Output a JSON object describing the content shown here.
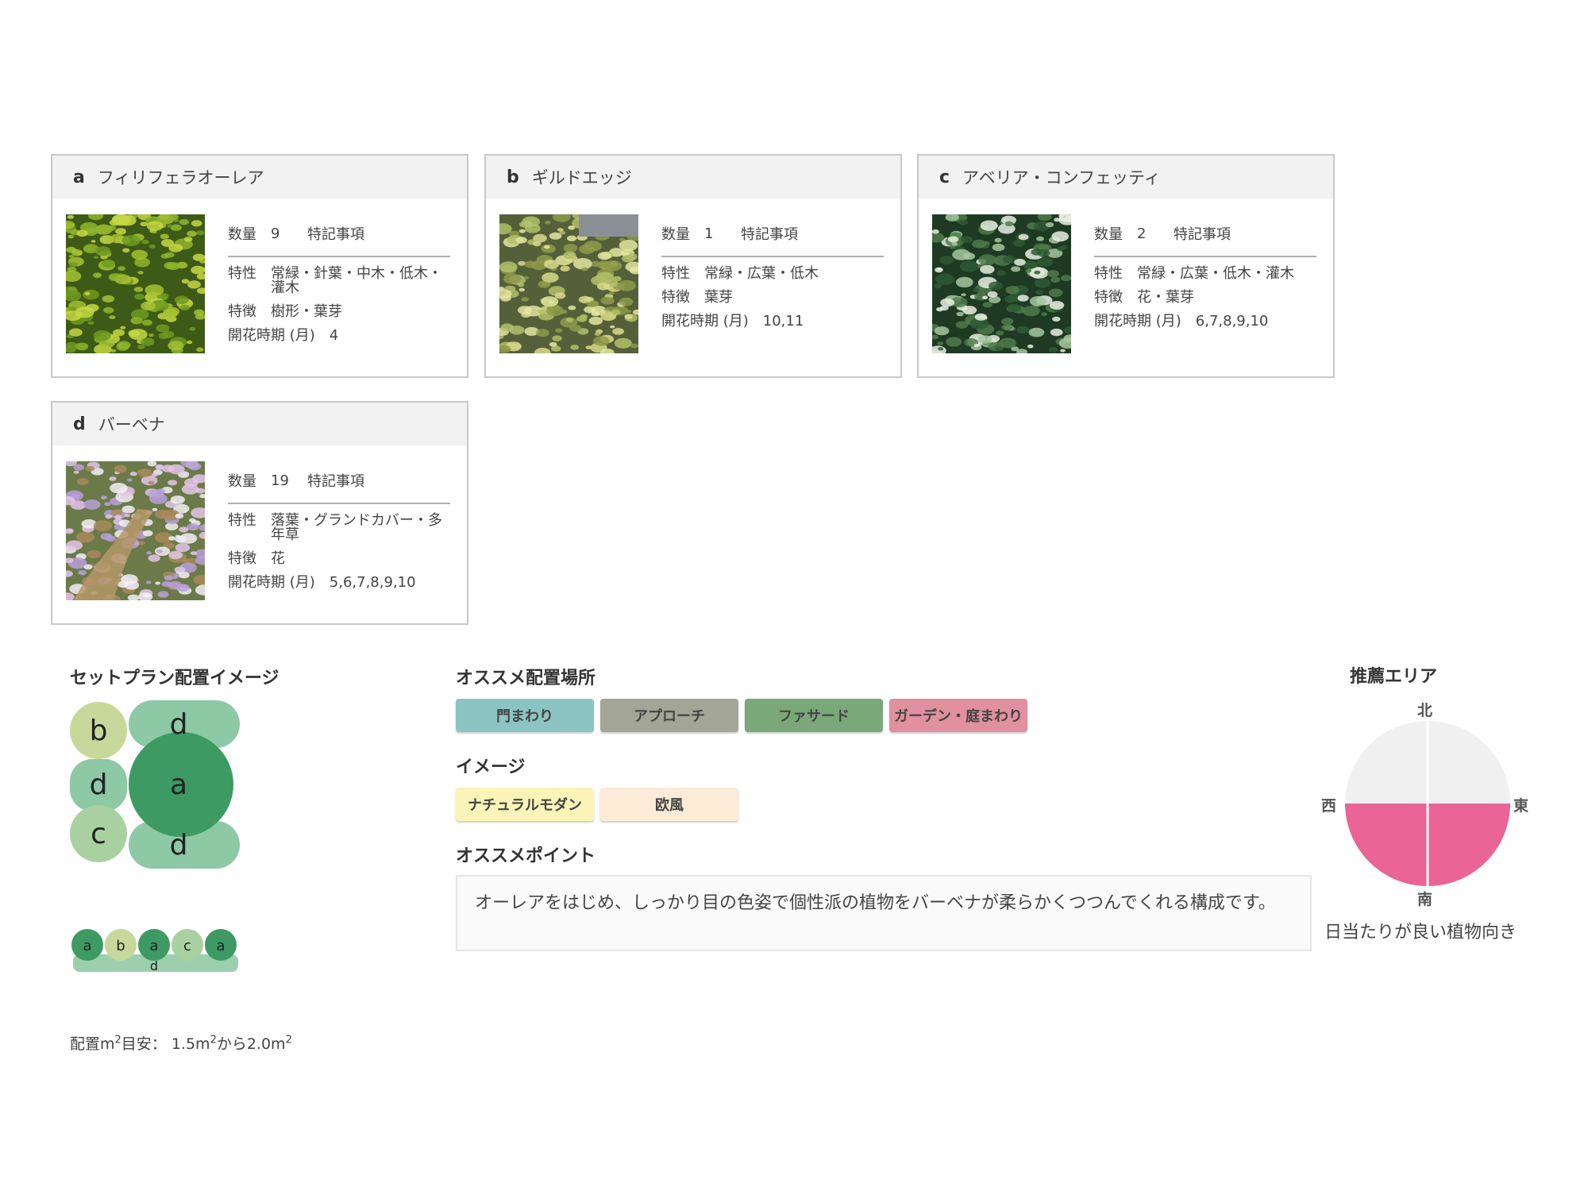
{
  "plants": [
    {
      "letter": "a",
      "name": "フィリフェラオーレア",
      "qty_label": "数量",
      "qty": "9",
      "note_label": "特記事項",
      "trait_label": "特性",
      "trait": "常緑・針葉・中木・低木・灌木",
      "feature_label": "特徴",
      "feature": "樹形・葉芽",
      "bloom_label": "開花時期 (月)",
      "bloom": "4"
    },
    {
      "letter": "b",
      "name": "ギルドエッジ",
      "qty_label": "数量",
      "qty": "1",
      "note_label": "特記事項",
      "trait_label": "特性",
      "trait": "常緑・広葉・低木",
      "feature_label": "特徴",
      "feature": "葉芽",
      "bloom_label": "開花時期 (月)",
      "bloom": "10,11"
    },
    {
      "letter": "c",
      "name": "アベリア・コンフェッティ",
      "qty_label": "数量",
      "qty": "2",
      "note_label": "特記事項",
      "trait_label": "特性",
      "trait": "常緑・広葉・低木・灌木",
      "feature_label": "特徴",
      "feature": "花・葉芽",
      "bloom_label": "開花時期 (月)",
      "bloom": "6,7,8,9,10"
    },
    {
      "letter": "d",
      "name": "バーベナ",
      "qty_label": "数量",
      "qty": "19",
      "note_label": "特記事項",
      "trait_label": "特性",
      "trait": "落葉・グランドカバー・多年草",
      "feature_label": "特徴",
      "feature": "花",
      "bloom_label": "開花時期 (月)",
      "bloom": "5,6,7,8,9,10"
    }
  ],
  "layout": {
    "title": "セットプラン配置イメージ",
    "grid_labels": [
      "b",
      "d",
      "d",
      "a",
      "c",
      "d"
    ],
    "row_labels": [
      "a",
      "b",
      "a",
      "c",
      "a",
      "d"
    ],
    "area_prefix": "配置m",
    "area_mid": "目安： 1.5m",
    "area_mid2": "から2.0m",
    "area_sup": "2"
  },
  "placement": {
    "title": "オススメ配置場所",
    "tags": [
      {
        "label": "門まわり",
        "color": "#8cc4c4"
      },
      {
        "label": "アプローチ",
        "color": "#a3a596"
      },
      {
        "label": "ファサード",
        "color": "#7aa878"
      },
      {
        "label": "ガーデン・庭まわり",
        "color": "#e0909e"
      }
    ]
  },
  "image_section": {
    "title": "イメージ",
    "tags": [
      {
        "label": "ナチュラルモダン",
        "color": "#fbf4b8"
      },
      {
        "label": "欧風",
        "color": "#fcebd6"
      }
    ]
  },
  "point": {
    "title": "オススメポイント",
    "text": "オーレアをはじめ、しっかり目の色姿で個性派の植物をバーベナが柔らかくつつんでくれる構成です。"
  },
  "area": {
    "title": "推薦エリア",
    "north": "北",
    "south": "南",
    "east": "東",
    "west": "西",
    "note": "日当たりが良い植物向き",
    "highlight_color": "#ea6496",
    "base_color": "#f0f0f0"
  }
}
